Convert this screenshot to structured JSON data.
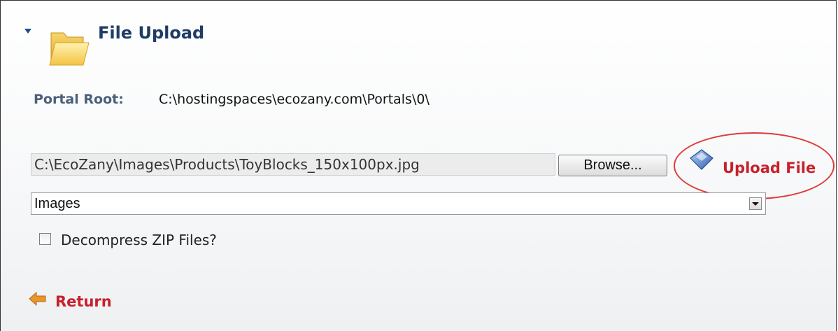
{
  "module": {
    "title": "File Upload"
  },
  "portal_root": {
    "label": "Portal Root:",
    "value": "C:\\hostingspaces\\ecozany.com\\Portals\\0\\"
  },
  "upload": {
    "file_path_value": "C:\\EcoZany\\Images\\Products\\ToyBlocks_150x100px.jpg",
    "browse_label": "Browse...",
    "upload_label": "Upload File"
  },
  "folder_select": {
    "selected": "Images"
  },
  "decompress": {
    "label": "Decompress ZIP Files?",
    "checked": false
  },
  "return_link": {
    "label": "Return"
  },
  "colors": {
    "accent_link": "#c8202a",
    "title": "#1f3c66",
    "highlight_ring": "#e03a3a"
  },
  "icons": {
    "collapse": "triangle-down-icon",
    "folder": "folder-icon",
    "upload": "upload-diamond-icon",
    "return": "arrow-left-icon"
  }
}
